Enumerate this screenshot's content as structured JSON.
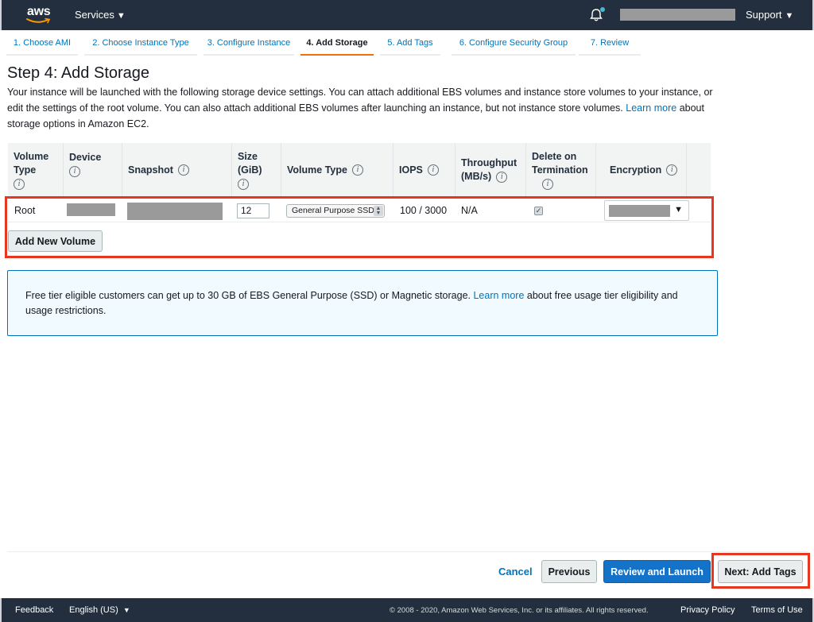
{
  "topnav": {
    "logo_text": "aws",
    "services_label": "Services",
    "support_label": "Support"
  },
  "wizard": {
    "tabs": [
      {
        "label": "1. Choose AMI"
      },
      {
        "label": "2. Choose Instance Type"
      },
      {
        "label": "3. Configure Instance"
      },
      {
        "label": "4. Add Storage",
        "active": true
      },
      {
        "label": "5. Add Tags"
      },
      {
        "label": "6. Configure Security Group"
      },
      {
        "label": "7. Review"
      }
    ]
  },
  "page": {
    "title": "Step 4: Add Storage",
    "intro_text": "Your instance will be launched with the following storage device settings. You can attach additional EBS volumes and instance store volumes to your instance, or edit the settings of the root volume. You can also attach additional EBS volumes after launching an instance, but not instance store volumes.",
    "intro_link": "Learn more",
    "intro_suffix": "about storage options in Amazon EC2."
  },
  "table": {
    "headers": {
      "volume_type_1": "Volume",
      "volume_type_2": "Type",
      "device": "Device",
      "snapshot": "Snapshot",
      "size_1": "Size",
      "size_2": "(GiB)",
      "vol_type": "Volume Type",
      "iops": "IOPS",
      "throughput_1": "Throughput",
      "throughput_2": "(MB/s)",
      "delete_1": "Delete on",
      "delete_2": "Termination",
      "encryption": "Encryption"
    },
    "row": {
      "volume_type": "Root",
      "size": "12",
      "vol_type_selected": "General Purpose SSD",
      "iops": "100 / 3000",
      "throughput": "N/A",
      "delete_on_termination": true
    },
    "add_volume_label": "Add New Volume"
  },
  "notice": {
    "text": "Free tier eligible customers can get up to 30 GB of EBS General Purpose (SSD) or Magnetic storage.",
    "link": "Learn more",
    "suffix": "about free usage tier eligibility and usage restrictions."
  },
  "actions": {
    "cancel_label": "Cancel",
    "previous_label": "Previous",
    "review_label": "Review and Launch",
    "next_label": "Next: Add Tags"
  },
  "footer": {
    "feedback_label": "Feedback",
    "language_label": "English (US)",
    "copyright": "© 2008 - 2020, Amazon Web Services, Inc. or its affiliates. All rights reserved.",
    "privacy_label": "Privacy Policy",
    "terms_label": "Terms of Use"
  },
  "colors": {
    "nav_bg": "#232f3e",
    "link": "#0073bb",
    "primary_button": "#1572c9",
    "active_tab_underline": "#ec7211",
    "annotation_red": "#e8371f",
    "notice_bg": "#f1faff"
  }
}
